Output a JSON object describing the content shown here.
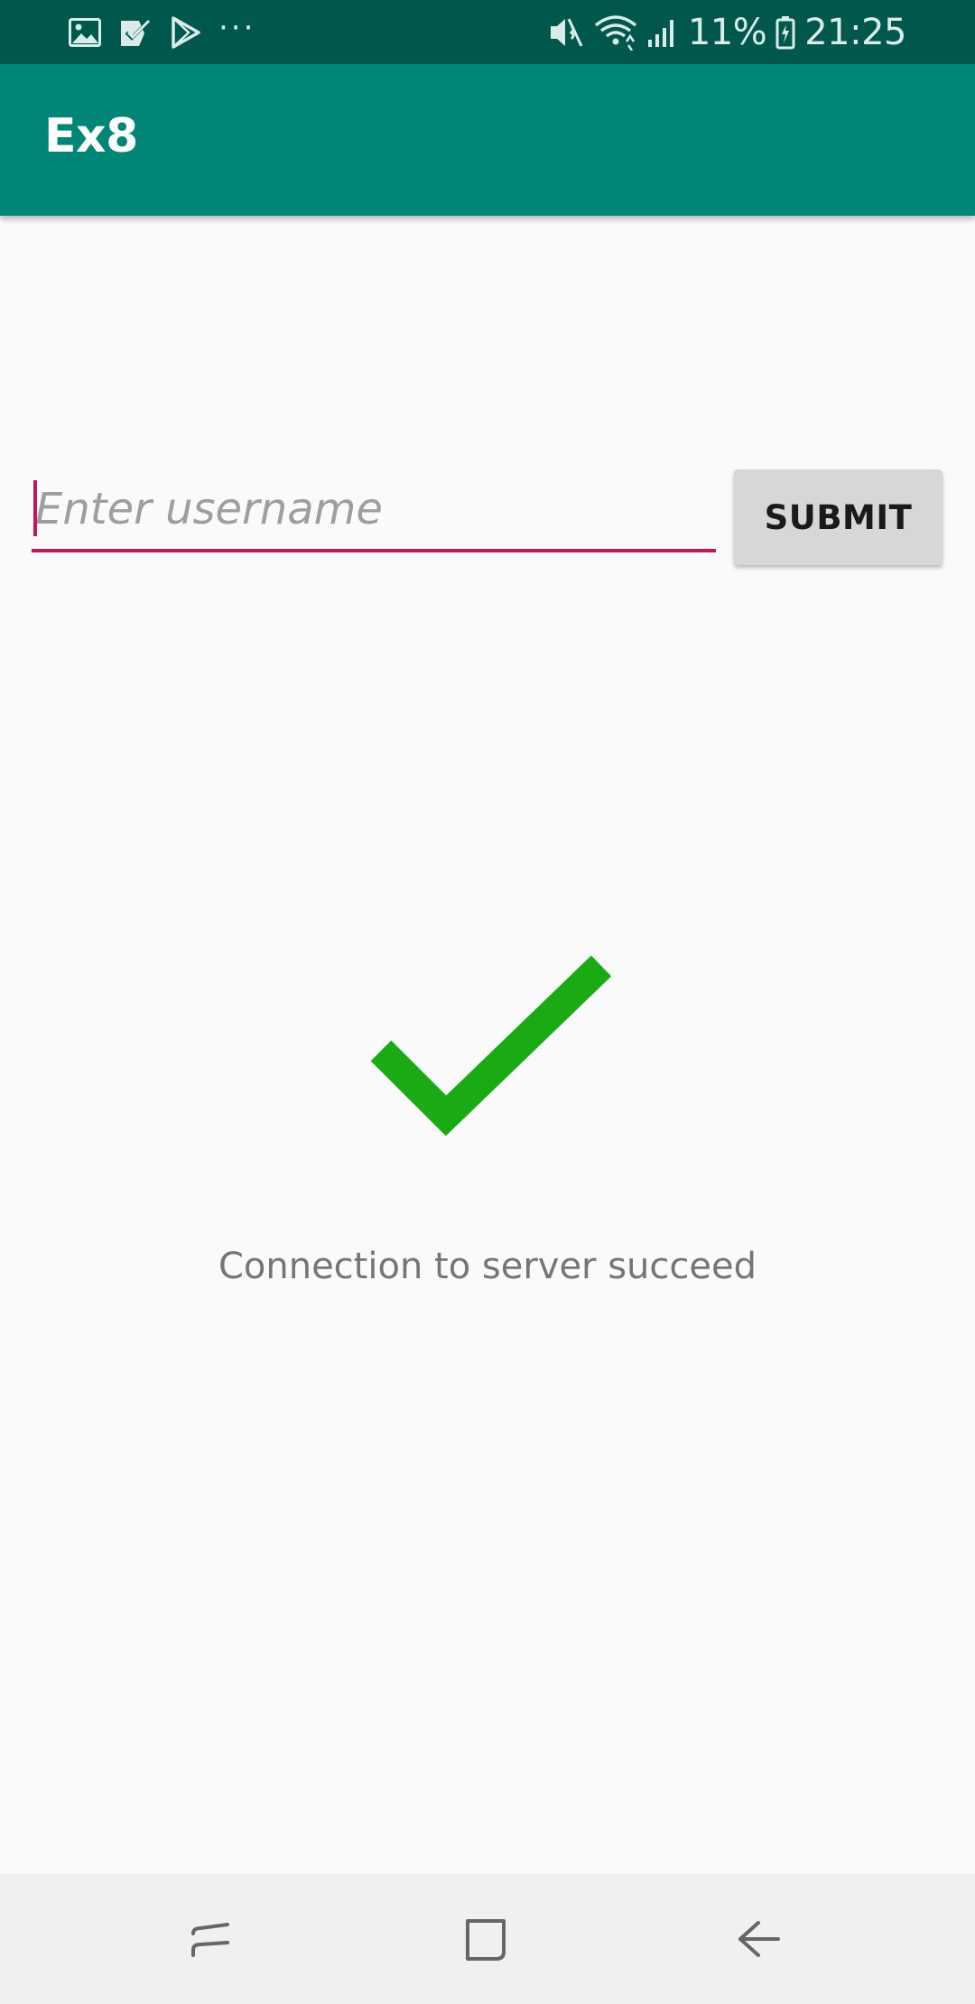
{
  "status_bar": {
    "battery_percent": "11%",
    "time": "21:25",
    "left_icons": [
      "gallery-icon",
      "task-check-icon",
      "play-store-icon",
      "more-dots-icon"
    ],
    "right_icons": [
      "mute-icon",
      "wifi-icon",
      "signal-icon",
      "battery-icon"
    ],
    "more_dots": "···"
  },
  "app_bar": {
    "title": "Ex8",
    "color": "#008577"
  },
  "form": {
    "username_placeholder": "Enter username",
    "username_value": "",
    "submit_label": "SUBMIT",
    "accent_color": "#c2185b"
  },
  "result": {
    "icon": "checkmark-icon",
    "icon_color": "#1aab14",
    "message": "Connection to server succeed"
  },
  "nav_bar": {
    "buttons": [
      "recents-icon",
      "home-icon",
      "back-icon"
    ]
  }
}
